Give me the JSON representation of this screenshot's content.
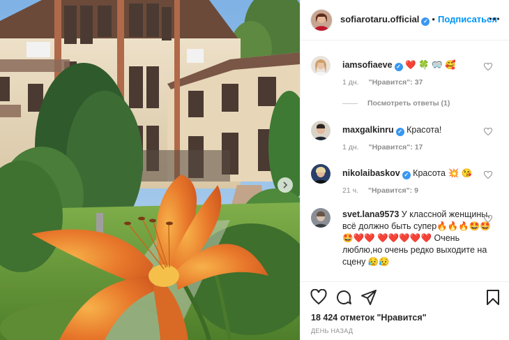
{
  "header": {
    "username": "sofiarotaru.official",
    "separator": "•",
    "follow_label": "Подписаться"
  },
  "comments": [
    {
      "username": "iamsofiaeve",
      "text": "",
      "emoji": "❤️ 🍀 🥽 🥰",
      "time": "1 дн.",
      "likes": "\"Нравится\": 37",
      "replies_label": "Посмотреть ответы (1)"
    },
    {
      "username": "maxgalkinru",
      "text": "Красота!",
      "time": "1 дн.",
      "likes": "\"Нравится\": 17"
    },
    {
      "username": "nikolaibaskov",
      "text": "Красота",
      "emoji": "💥 😘",
      "time": "21 ч.",
      "likes": "\"Нравится\": 9"
    },
    {
      "username": "svet.lana9573",
      "text_1": "У классной женщины, всё должно быть супер",
      "emoji_1": "🔥🔥🔥🤩🤩🤩❤️❤️",
      "emoji_2": "❤️❤️❤️❤️❤️",
      "text_2": "Очень люблю,но очень редко выходите на сцену",
      "emoji_3": "😥😥"
    }
  ],
  "footer": {
    "likes_total": "18 424 отметок \"Нравится\"",
    "date": "ДЕНЬ НАЗАД"
  },
  "colors": {
    "accent": "#0095f6",
    "verified": "#3897f0",
    "muted": "#8e8e8e",
    "heart": "#ed2d2d"
  },
  "icons": {
    "more": "more-horizontal-icon",
    "like": "heart-outline-icon",
    "comment": "comment-bubble-icon",
    "share": "paper-plane-icon",
    "save": "bookmark-icon",
    "next": "chevron-right-icon"
  }
}
